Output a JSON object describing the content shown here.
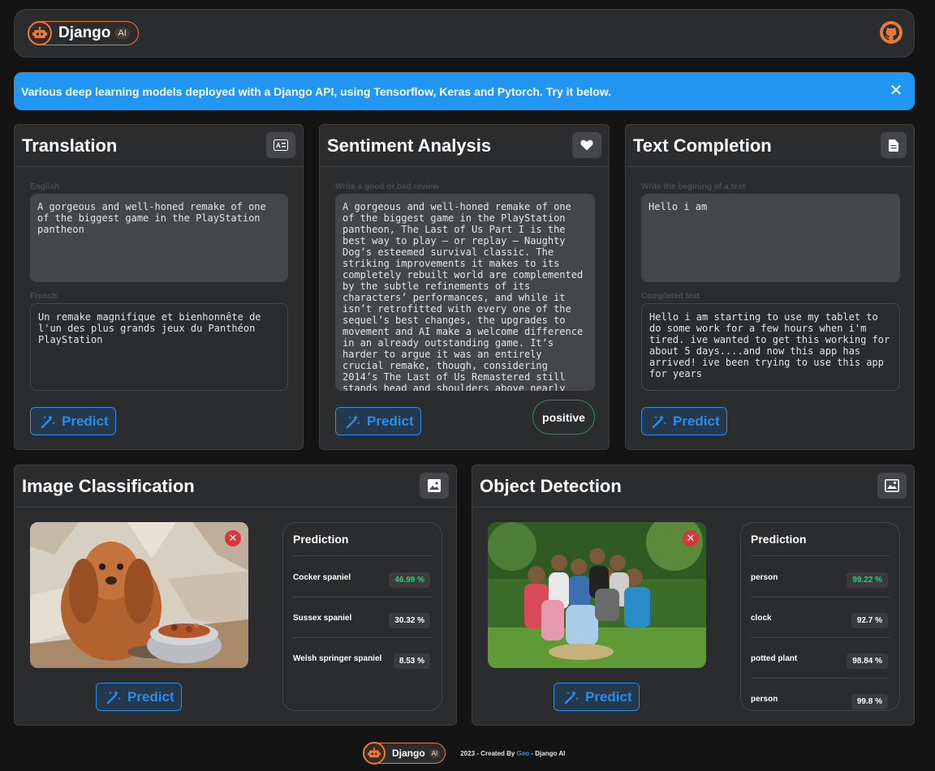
{
  "navbar": {
    "brand_name": "Django",
    "brand_badge": "AI",
    "github_icon": "github-icon"
  },
  "alert": {
    "message": "Various deep learning models deployed with a Django API, using Tensorflow, Keras and Pytorch. Try it below.",
    "close_icon": "close-icon"
  },
  "translation": {
    "title": "Translation",
    "icon": "language-card-icon",
    "input_label": "English",
    "input_value": "A gorgeous and well-honed remake of one of the biggest game in the PlayStation pantheon",
    "output_label": "French",
    "output_value": "Un remake magnifique et bienhonnête de l'un des plus grands jeux du Panthéon PlayStation",
    "predict_label": "Predict"
  },
  "sentiment": {
    "title": "Sentiment Analysis",
    "icon": "heart-icon",
    "input_label": "Write a good or bad review",
    "input_value": "A gorgeous and well-honed remake of one of the biggest game in the PlayStation pantheon, The Last of Us Part I is the best way to play – or replay – Naughty Dog’s esteemed survival classic. The striking improvements it makes to its completely rebuilt world are complemented by the subtle refinements of its characters’ performances, and while it isn’t retrofitted with every one of the sequel’s best changes, the upgrades to movement and AI make a welcome difference in an already outstanding game. It’s harder to argue it was an entirely crucial remake, though, considering 2014’s The Last of Us Remastered still stands head and shoulders above nearly all of its",
    "predict_label": "Predict",
    "result": "positive"
  },
  "completion": {
    "title": "Text Completion",
    "icon": "document-icon",
    "input_label": "Write the begining of a text",
    "input_value": "Hello i am",
    "output_label": "Completed text",
    "output_value": "Hello i am starting to use my tablet to do some work for a few hours when i'm tired. ive wanted to get this working for about 5 days....and now this app has arrived! ive been trying to use this app for years",
    "predict_label": "Predict"
  },
  "classification": {
    "title": "Image Classification",
    "icon": "image-icon",
    "predict_label": "Predict",
    "remove_icon": "remove-image-icon",
    "prediction_title": "Prediction",
    "predictions": [
      {
        "label": "Cocker spaniel",
        "value": "46.99 %",
        "highlight": true
      },
      {
        "label": "Sussex spaniel",
        "value": "30.32 %",
        "highlight": false
      },
      {
        "label": "Welsh springer spaniel",
        "value": "8.53 %",
        "highlight": false
      }
    ]
  },
  "detection": {
    "title": "Object Detection",
    "icon": "image-search-icon",
    "predict_label": "Predict",
    "remove_icon": "remove-image-icon",
    "prediction_title": "Prediction",
    "predictions": [
      {
        "label": "person",
        "value": "99.22 %",
        "highlight": true
      },
      {
        "label": "clock",
        "value": "92.7 %",
        "highlight": false
      },
      {
        "label": "potted plant",
        "value": "98.84 %",
        "highlight": false
      },
      {
        "label": "person",
        "value": "99.8 %",
        "highlight": false
      }
    ]
  },
  "footer": {
    "brand_name": "Django",
    "brand_badge": "AI",
    "credit_prefix": "2023 - Created By ",
    "credit_link": "Geo",
    "credit_suffix": " - Django AI"
  },
  "colors": {
    "accent": "#2196f3",
    "brand": "#e57a3a",
    "success": "#2ecc71",
    "danger": "#d9363e"
  }
}
